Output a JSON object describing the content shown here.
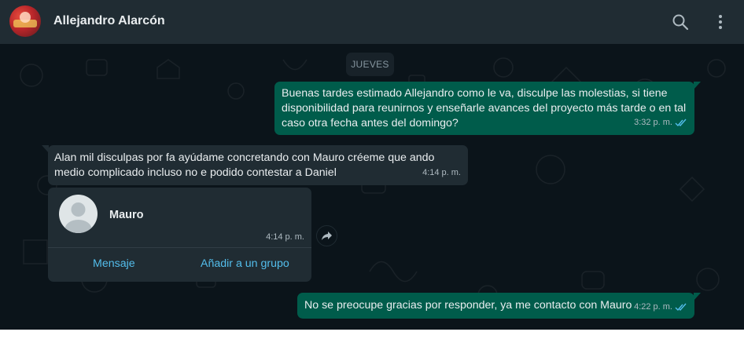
{
  "header": {
    "contact_name": "Allejandro Alarcón",
    "avatar_icon": "contact-avatar",
    "search_icon": "search-icon",
    "menu_icon": "more-vertical-icon"
  },
  "date_chip": "JUEVES",
  "messages": [
    {
      "direction": "out",
      "text": "Buenas tardes estimado Allejandro como le va, disculpe las molestias, si tiene disponibilidad para reunirnos y enseñarle avances del proyecto más tarde o en tal caso otra fecha antes del domingo?",
      "time": "3:32 p. m.",
      "status_icon": "double-check-read-icon"
    },
    {
      "direction": "in",
      "text": "Alan mil disculpas por fa ayúdame concretando con Mauro créeme que ando medio complicado incluso no e podido contestar a Daniel",
      "time": "4:14 p. m."
    },
    {
      "direction": "out",
      "text": "No se preocupe gracias por responder, ya me contacto con Mauro",
      "time": "4:22 p. m.",
      "status_icon": "double-check-read-icon"
    }
  ],
  "contact_card": {
    "name": "Mauro",
    "time": "4:14 p. m.",
    "message_label": "Mensaje",
    "add_to_group_label": "Añadir a un grupo",
    "forward_icon": "forward-icon"
  },
  "colors": {
    "background": "#0b141a",
    "header": "#202c33",
    "outgoing_bubble": "#005c4b",
    "incoming_bubble": "#202c33",
    "link": "#53bdeb",
    "read_check": "#53bdeb"
  }
}
